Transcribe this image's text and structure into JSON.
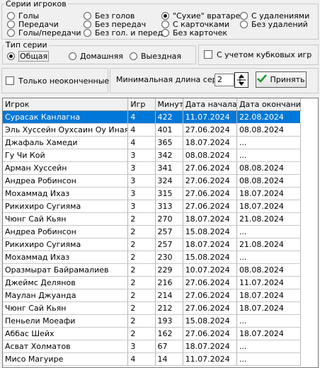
{
  "series_types": {
    "title": "Серии игроков",
    "options": [
      {
        "label": "Голы",
        "selected": false
      },
      {
        "label": "Без голов",
        "selected": false
      },
      {
        "label": "\"Сухие\" вратарей",
        "selected": true
      },
      {
        "label": "С удалениями",
        "selected": false
      },
      {
        "label": "Передачи",
        "selected": false
      },
      {
        "label": "Без передач",
        "selected": false
      },
      {
        "label": "С карточками",
        "selected": false
      },
      {
        "label": "Без удалений",
        "selected": false
      },
      {
        "label": "Голы/передачи",
        "selected": false
      },
      {
        "label": "Без гол. и перед.",
        "selected": false
      },
      {
        "label": "Без карточек",
        "selected": false
      }
    ]
  },
  "series_kind": {
    "title": "Тип серии",
    "options": [
      {
        "label": "Общая",
        "selected": true
      },
      {
        "label": "Домашняя",
        "selected": false
      },
      {
        "label": "Выездная",
        "selected": false
      }
    ]
  },
  "cup_games": {
    "label": "С учетом кубковых игр",
    "checked": false
  },
  "unfinished_only": {
    "label": "Только неоконченные",
    "checked": false
  },
  "min_length": {
    "label": "Минимальная длина серии",
    "value": "2"
  },
  "accept_button": {
    "label": "Принять"
  },
  "table": {
    "columns": [
      "Игрок",
      "Игр",
      "Минут",
      "Дата начала",
      "Дата окончания"
    ],
    "selected_row": 0,
    "rows": [
      [
        "Сурасак Канлагна",
        "4",
        "422",
        "11.07.2024",
        "22.08.2024"
      ],
      [
        "Эль Хуссейн Оухсаин Оу Инаятт",
        "4",
        "401",
        "27.06.2024",
        "08.08.2024"
      ],
      [
        "Джафаль Хамеди",
        "4",
        "365",
        "18.07.2024",
        "..."
      ],
      [
        "Гу Чи Кой",
        "3",
        "342",
        "08.08.2024",
        "..."
      ],
      [
        "Арман Хуссейн",
        "3",
        "341",
        "27.06.2024",
        "08.08.2024"
      ],
      [
        "Андреа Робинсон",
        "3",
        "324",
        "27.06.2024",
        "08.08.2024"
      ],
      [
        "Мохаммад Ихаз",
        "3",
        "315",
        "27.06.2024",
        "18.07.2024"
      ],
      [
        "Рикихиро Сугияма",
        "3",
        "313",
        "27.06.2024",
        "18.07.2024"
      ],
      [
        "Чюнг Сай Кьян",
        "2",
        "270",
        "18.07.2024",
        "21.08.2024"
      ],
      [
        "Андреа Робинсон",
        "2",
        "257",
        "15.08.2024",
        "..."
      ],
      [
        "Рикихиро Сугияма",
        "2",
        "257",
        "18.07.2024",
        "21.08.2024"
      ],
      [
        "Мохаммад Ихаз",
        "2",
        "230",
        "15.08.2024",
        "..."
      ],
      [
        "Оразмырат Байрамалиев",
        "2",
        "229",
        "10.07.2024",
        "08.08.2024"
      ],
      [
        "Джеймс Делянов",
        "2",
        "216",
        "27.06.2024",
        "11.07.2024"
      ],
      [
        "Маулан Джуанда",
        "2",
        "214",
        "27.06.2024",
        "18.07.2024"
      ],
      [
        "Чюнг Сай Кьян",
        "2",
        "212",
        "27.06.2024",
        "18.07.2024"
      ],
      [
        "Пеньели Моеафи",
        "2",
        "193",
        "15.08.2024",
        "..."
      ],
      [
        "Аббас Шейх",
        "2",
        "162",
        "27.06.2024",
        "18.07.2024"
      ],
      [
        "Асват Холматов",
        "3",
        "67",
        "18.07.2024",
        "..."
      ],
      [
        "Мисо Магуире",
        "4",
        "14",
        "11.07.2024",
        "..."
      ]
    ]
  }
}
